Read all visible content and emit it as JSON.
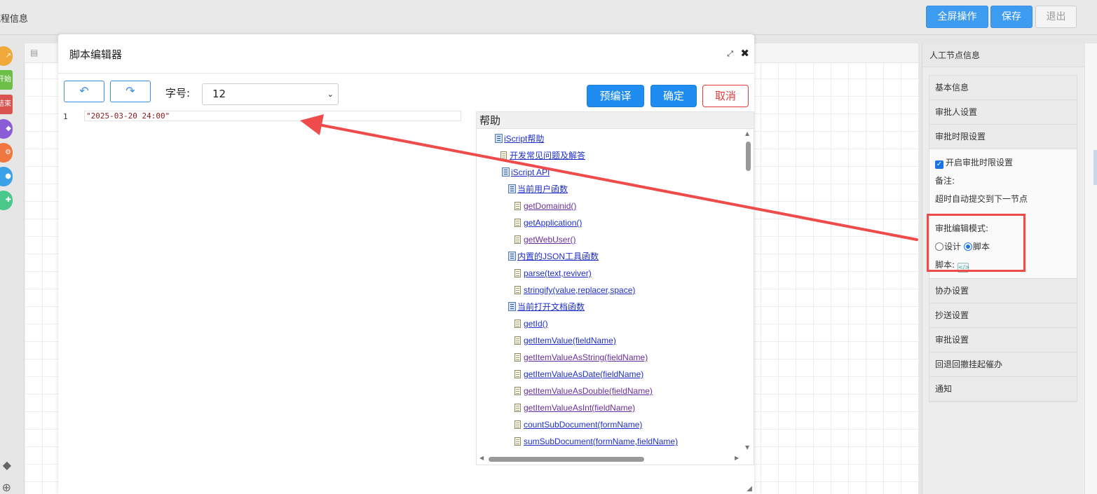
{
  "topbar": {
    "crumb": "流程信息",
    "fullscreen_label": "全屏操作",
    "save_label": "保存",
    "exit_label": "退出"
  },
  "lefttools": [
    "",
    "开始",
    "结束",
    "",
    "",
    "",
    ""
  ],
  "right_panel": {
    "title": "人工节点信息",
    "items_top": [
      "基本信息",
      "审批人设置",
      "审批时限设置"
    ],
    "enable_time_limit": "开启审批时限设置",
    "remark_label": "备注:",
    "remark_value": "超时自动提交到下一节点",
    "edit_mode_label": "审批编辑模式:",
    "mode_design": "设计",
    "mode_script": "脚本",
    "script_label": "脚本:",
    "items_bottom": [
      "协办设置",
      "抄送设置",
      "审批设置",
      "回退回撤挂起催办",
      "通知"
    ]
  },
  "modal": {
    "title": "脚本编辑器",
    "undo_icon": "undo-icon",
    "redo_icon": "redo-icon",
    "font_label": "字号:",
    "font_size": "12",
    "precompile_label": "预编译",
    "ok_label": "确定",
    "cancel_label": "取消",
    "editor": {
      "line_number": "1",
      "code": "\"2025-03-20 24:00\""
    },
    "help": {
      "title": "帮助",
      "tree": [
        {
          "label": "iScript帮助",
          "type": "book"
        },
        {
          "label": "开发常见问题及解答",
          "type": "page"
        },
        {
          "label": "iScript API",
          "type": "book"
        },
        {
          "label": "当前用户函数",
          "type": "book"
        },
        {
          "label": "getDomainid()",
          "type": "page"
        },
        {
          "label": "getApplication()",
          "type": "page"
        },
        {
          "label": "getWebUser()",
          "type": "page"
        },
        {
          "label": "内置的JSON工具函数",
          "type": "book"
        },
        {
          "label": "parse(text,reviver)",
          "type": "page"
        },
        {
          "label": "stringify(value,replacer,space)",
          "type": "page"
        },
        {
          "label": "当前打开文档函数",
          "type": "book"
        },
        {
          "label": "getId()",
          "type": "page"
        },
        {
          "label": "getItemValue(fieldName)",
          "type": "page"
        },
        {
          "label": "getItemValueAsString(fieldName)",
          "type": "page"
        },
        {
          "label": "getItemValueAsDate(fieldName)",
          "type": "page"
        },
        {
          "label": "getItemValueAsDouble(fieldName)",
          "type": "page"
        },
        {
          "label": "getItemValueAsInt(fieldName)",
          "type": "page"
        },
        {
          "label": "countSubDocument(formName)",
          "type": "page"
        },
        {
          "label": "sumSubDocument(formName,fieldName)",
          "type": "page"
        }
      ]
    }
  },
  "colors": {
    "primary": "#1e8cf0",
    "danger": "#e23a3a",
    "annotation": "#ef4b4b",
    "link": "#1f2fc8",
    "visited": "#6a2e9a"
  }
}
